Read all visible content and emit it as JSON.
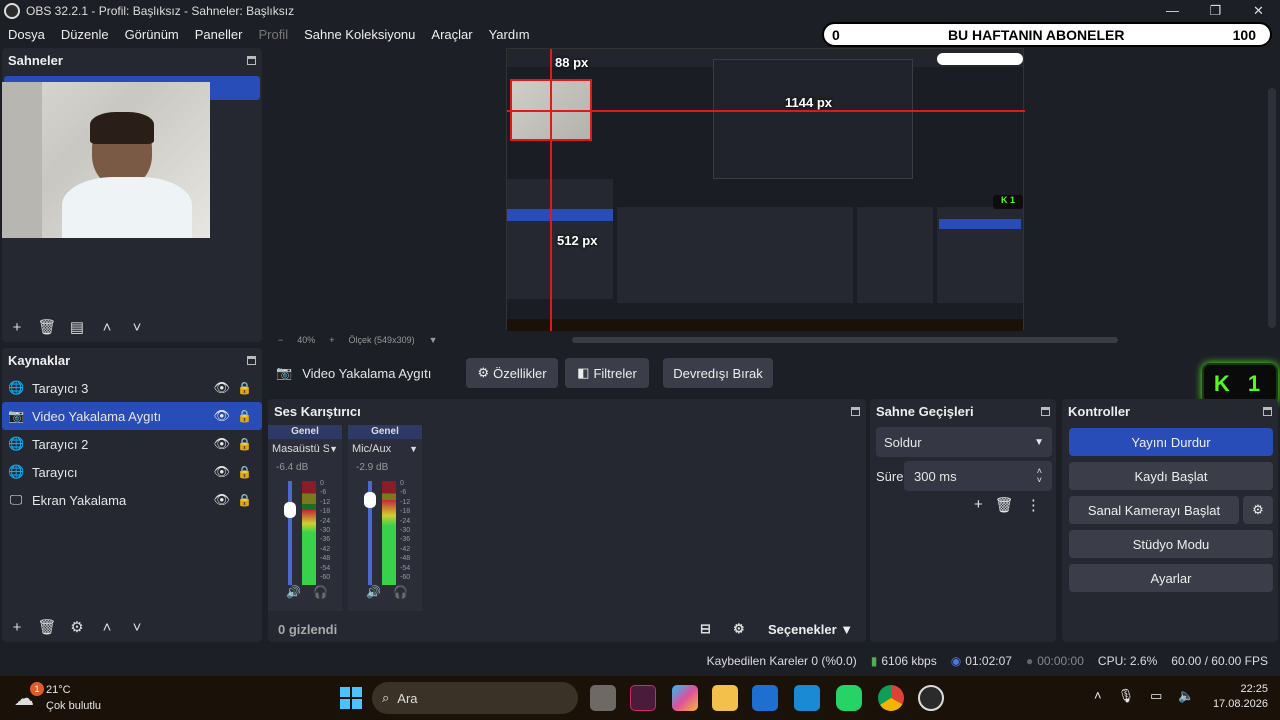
{
  "window": {
    "title": "OBS 32.2.1 - Profil: Başlıksız - Sahneler: Başlıksız"
  },
  "menu": [
    "Dosya",
    "Düzenle",
    "Görünüm",
    "Paneller",
    "Profil",
    "Sahne Koleksiyonu",
    "Araçlar",
    "Yardım"
  ],
  "sub_bar": {
    "left": "0",
    "title": "BU HAFTANIN ABONELER",
    "right": "100"
  },
  "scenes": {
    "title": "Sahneler"
  },
  "preview": {
    "zoom": "40%",
    "scale_label": "Ölçek (549x309)",
    "dim_w": "88 px",
    "dim_w2": "1144 px",
    "dim_h": "512 px"
  },
  "sources": {
    "title": "Kaynaklar",
    "items": [
      {
        "label": "Tarayıcı 3",
        "icon": "globe",
        "selected": false
      },
      {
        "label": "Video Yakalama Aygıtı",
        "icon": "camera",
        "selected": true
      },
      {
        "label": "Tarayıcı 2",
        "icon": "globe",
        "selected": false
      },
      {
        "label": "Tarayıcı",
        "icon": "globe",
        "selected": false
      },
      {
        "label": "Ekran Yakalama",
        "icon": "monitor",
        "selected": false
      }
    ]
  },
  "context_bar": {
    "source": "Video Yakalama Aygıtı",
    "props": "Özellikler",
    "filters": "Filtreler",
    "disable": "Devredışı Bırak"
  },
  "mixer": {
    "title": "Ses Karıştırıcı",
    "hidden": "0 gizlendi",
    "options": "Seçenekler",
    "channels": [
      {
        "group": "Genel",
        "name": "Masaüstü Ses",
        "db": "-6.4 dB",
        "level": 0.72
      },
      {
        "group": "Genel",
        "name": "Mic/Aux",
        "db": "-2.9 dB",
        "level": 0.82
      }
    ],
    "scale": [
      "0",
      "-6",
      "-12",
      "-18",
      "-24",
      "-30",
      "-36",
      "-42",
      "-48",
      "-54",
      "-60"
    ]
  },
  "transitions": {
    "title": "Sahne Geçişleri",
    "type": "Soldur",
    "duration_label": "Süre",
    "duration": "300 ms"
  },
  "controls": {
    "title": "Kontroller",
    "stop_stream": "Yayını Durdur",
    "start_record": "Kaydı Başlat",
    "virtual_cam": "Sanal Kamerayı Başlat",
    "studio": "Stüdyo Modu",
    "settings": "Ayarlar"
  },
  "kick": {
    "text": "K 1"
  },
  "status": {
    "dropped": "Kaybedilen Kareler 0 (%0.0)",
    "bitrate": "6106 kbps",
    "live_time": "01:02:07",
    "rec_time": "00:00:00",
    "cpu": "CPU: 2.6%",
    "fps": "60.00 / 60.00 FPS"
  },
  "taskbar": {
    "weather_temp": "21°C",
    "weather_desc": "Çok bulutlu",
    "weather_badge": "1",
    "search": "Ara",
    "time": "22:25",
    "date": "17.08.2026"
  },
  "colors": {
    "accent": "#284cb8",
    "bg": "#1d1f26",
    "panel": "#252831"
  }
}
